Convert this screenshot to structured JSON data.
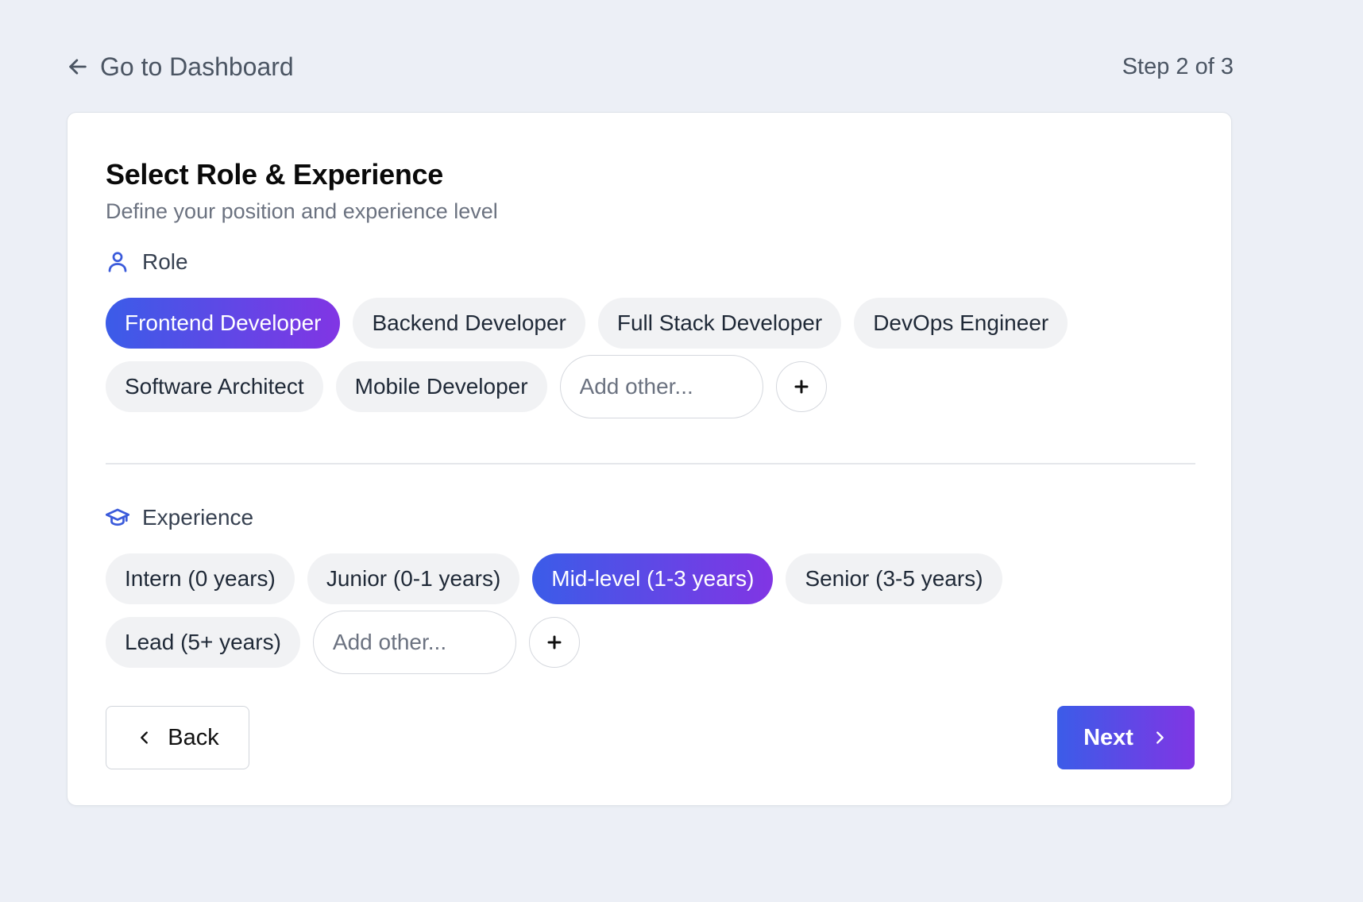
{
  "header": {
    "back_link_label": "Go to Dashboard",
    "back_icon": "arrow-left-icon",
    "step_indicator": "Step 2 of 3"
  },
  "card": {
    "title": "Select Role & Experience",
    "subtitle": "Define your position and experience level"
  },
  "role": {
    "label": "Role",
    "icon": "user-icon",
    "options": [
      {
        "label": "Frontend Developer",
        "selected": true
      },
      {
        "label": "Backend Developer",
        "selected": false
      },
      {
        "label": "Full Stack Developer",
        "selected": false
      },
      {
        "label": "DevOps Engineer",
        "selected": false
      },
      {
        "label": "Software Architect",
        "selected": false
      },
      {
        "label": "Mobile Developer",
        "selected": false
      }
    ],
    "add_placeholder": "Add other...",
    "add_value": ""
  },
  "experience": {
    "label": "Experience",
    "icon": "graduation-cap-icon",
    "options": [
      {
        "label": "Intern (0 years)",
        "selected": false
      },
      {
        "label": "Junior (0-1 years)",
        "selected": false
      },
      {
        "label": "Mid-level (1-3 years)",
        "selected": true
      },
      {
        "label": "Senior (3-5 years)",
        "selected": false
      },
      {
        "label": "Lead (5+ years)",
        "selected": false
      }
    ],
    "add_placeholder": "Add other...",
    "add_value": ""
  },
  "footer": {
    "back_label": "Back",
    "next_label": "Next"
  },
  "colors": {
    "background": "#eceff6",
    "accent_gradient_start": "#3b5ce8",
    "accent_gradient_end": "#8135e4",
    "chip_background": "#f1f2f4",
    "icon_accent": "#3b5bdb"
  }
}
